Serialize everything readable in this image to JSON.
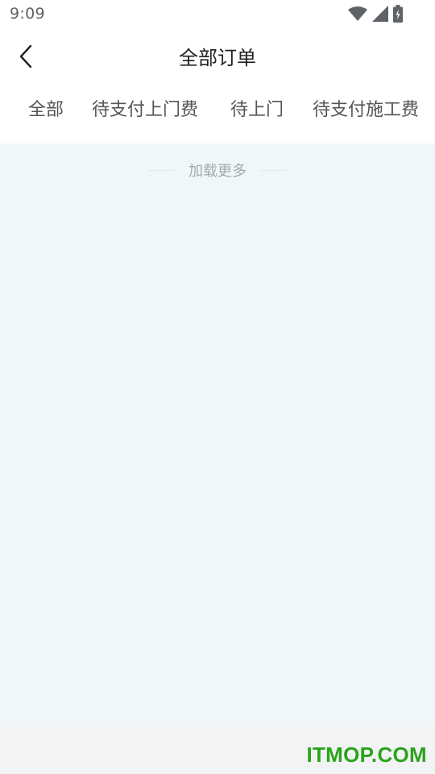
{
  "status_bar": {
    "time": "9:09"
  },
  "header": {
    "title": "全部订单"
  },
  "tabs": [
    {
      "label": "全部"
    },
    {
      "label": "待支付上门费"
    },
    {
      "label": "待上门"
    },
    {
      "label": "待支付施工费"
    }
  ],
  "content": {
    "load_more": "加载更多"
  },
  "watermark": {
    "text": "ITMOP.COM",
    "color": "#2aa31b"
  },
  "colors": {
    "content_background": "#eff7fb",
    "bottom_background": "#f2f3f5",
    "tab_text": "#555555",
    "title_text": "#222222",
    "hint_text": "#a5a9ab"
  }
}
